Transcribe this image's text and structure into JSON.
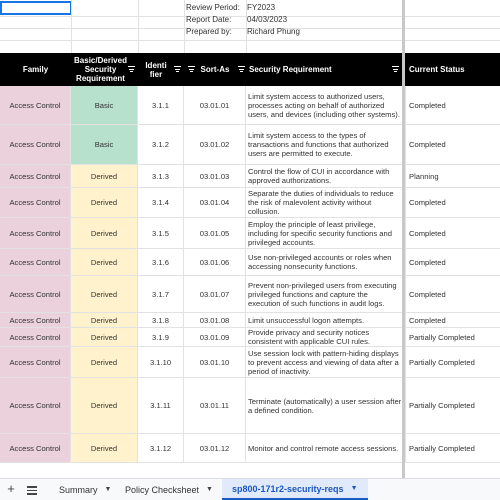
{
  "meta": {
    "review_period_label": "Review Period:",
    "review_period_value": "FY2023",
    "report_date_label": "Report Date:",
    "report_date_value": "04/03/2023",
    "prepared_by_label": "Prepared by:",
    "prepared_by_value": "Richard Phung"
  },
  "table": {
    "headers": {
      "family": "Family",
      "basic_derived": "Basic/Derived Security Requirement",
      "identifier": "Identifier",
      "sort_as": "Sort-As",
      "security_requirement": "Security Requirement",
      "current_status": "Current Status"
    },
    "rows": [
      {
        "family": "Access Control",
        "type": "Basic",
        "id": "3.1.1",
        "sort": "03.01.01",
        "req": "Limit system access to authorized users, processes acting on behalf of authorized users, and devices (including other systems).",
        "status": "Completed"
      },
      {
        "family": "Access Control",
        "type": "Basic",
        "id": "3.1.2",
        "sort": "03.01.02",
        "req": "Limit system access to the types of transactions and functions that authorized users are permitted to execute.",
        "status": "Completed"
      },
      {
        "family": "Access Control",
        "type": "Derived",
        "id": "3.1.3",
        "sort": "03.01.03",
        "req": "Control the flow of CUI in accordance with approved authorizations.",
        "status": "Planning"
      },
      {
        "family": "Access Control",
        "type": "Derived",
        "id": "3.1.4",
        "sort": "03.01.04",
        "req": "Separate the duties of individuals to reduce the risk of malevolent activity without collusion.",
        "status": "Completed"
      },
      {
        "family": "Access Control",
        "type": "Derived",
        "id": "3.1.5",
        "sort": "03.01.05",
        "req": "Employ the principle of least privilege, including for specific security functions and privileged accounts.",
        "status": "Completed"
      },
      {
        "family": "Access Control",
        "type": "Derived",
        "id": "3.1.6",
        "sort": "03.01.06",
        "req": "Use non-privileged accounts or roles when accessing nonsecurity functions.",
        "status": "Completed"
      },
      {
        "family": "Access Control",
        "type": "Derived",
        "id": "3.1.7",
        "sort": "03.01.07",
        "req": "Prevent non-privileged users from executing privileged functions and capture the execution of such functions in audit logs.",
        "status": "Completed"
      },
      {
        "family": "Access Control",
        "type": "Derived",
        "id": "3.1.8",
        "sort": "03.01.08",
        "req": "Limit unsuccessful logon attempts.",
        "status": "Completed"
      },
      {
        "family": "Access Control",
        "type": "Derived",
        "id": "3.1.9",
        "sort": "03.01.09",
        "req": "Provide privacy and security notices consistent with applicable CUI rules.",
        "status": "Partially Completed"
      },
      {
        "family": "Access Control",
        "type": "Derived",
        "id": "3.1.10",
        "sort": "03.01.10",
        "req": "Use session lock with pattern-hiding displays to prevent access and viewing of data after a period of inactivity.",
        "status": "Partially Completed"
      },
      {
        "family": "Access Control",
        "type": "Derived",
        "id": "3.1.11",
        "sort": "03.01.11",
        "req": "Terminate (automatically) a user session after a defined condition.",
        "status": "Partially Completed"
      },
      {
        "family": "Access Control",
        "type": "Derived",
        "id": "3.1.12",
        "sort": "03.01.12",
        "req": "Monitor and control remote access sessions.",
        "status": "Partially Completed"
      }
    ]
  },
  "tabbar": {
    "add_icon": "plus-icon",
    "menu_icon": "all-sheets-menu-icon",
    "tabs": [
      {
        "label": "Summary",
        "active": false
      },
      {
        "label": "Policy Checksheet",
        "active": false
      },
      {
        "label": "sp800-171r2-security-reqs",
        "active": true
      }
    ]
  },
  "colors": {
    "header_bg": "#000000",
    "family_bg": "#ead1dc",
    "basic_bg": "#b7e1cd",
    "derived_bg": "#fff2cc",
    "active_tab": "#1a56c4"
  }
}
